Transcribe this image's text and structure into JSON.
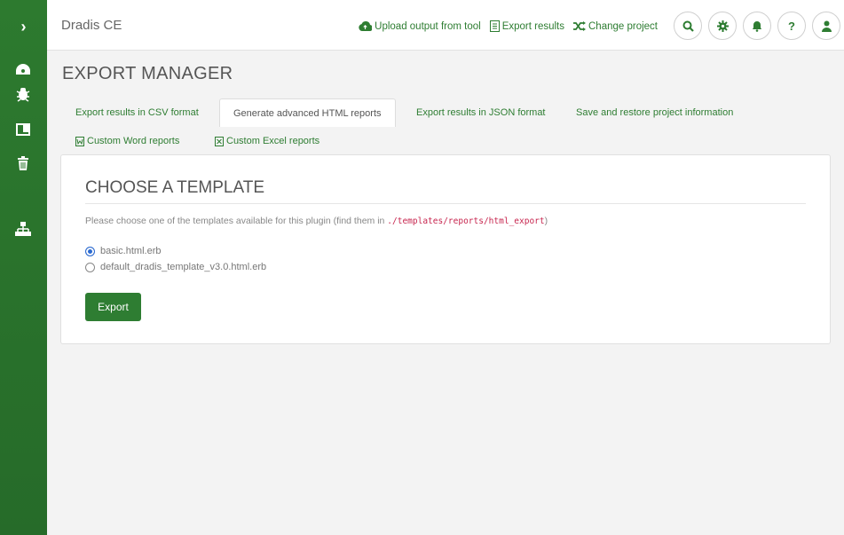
{
  "app": {
    "name": "Dradis CE"
  },
  "header": {
    "links": [
      {
        "label": "Upload output from tool",
        "icon": "cloud-upload-icon"
      },
      {
        "label": "Export results",
        "icon": "file-export-icon"
      },
      {
        "label": "Change project",
        "icon": "shuffle-icon"
      }
    ],
    "buttons": [
      "search-icon",
      "gear-icon",
      "bell-icon",
      "help-icon",
      "user-icon"
    ],
    "help_glyph": "?"
  },
  "sidebar": {
    "items": [
      "dashboard-icon",
      "bug-icon",
      "book-icon",
      "trash-icon",
      "sitemap-icon"
    ]
  },
  "page": {
    "title": "EXPORT MANAGER"
  },
  "tabs": [
    {
      "label": "Export results in CSV format"
    },
    {
      "label": "Generate advanced HTML reports"
    },
    {
      "label": "Export results in JSON format"
    },
    {
      "label": "Save and restore project information"
    },
    {
      "label": "Custom Word reports"
    },
    {
      "label": "Custom Excel reports"
    }
  ],
  "active_tab": "Generate advanced HTML reports",
  "panel": {
    "heading": "CHOOSE A TEMPLATE",
    "hint": "Please choose one of the templates available for this plugin (find them in",
    "hint_path": "./templates/reports/html_export",
    "hint_close": ")",
    "templates": [
      {
        "label": "basic.html.erb",
        "selected": true
      },
      {
        "label": "default_dradis_template_v3.0.html.erb",
        "selected": false
      }
    ],
    "export_label": "Export"
  },
  "colors": {
    "accent": "#2e7d32",
    "radio_selected": "#2d6bd0",
    "code": "#c7254e"
  }
}
